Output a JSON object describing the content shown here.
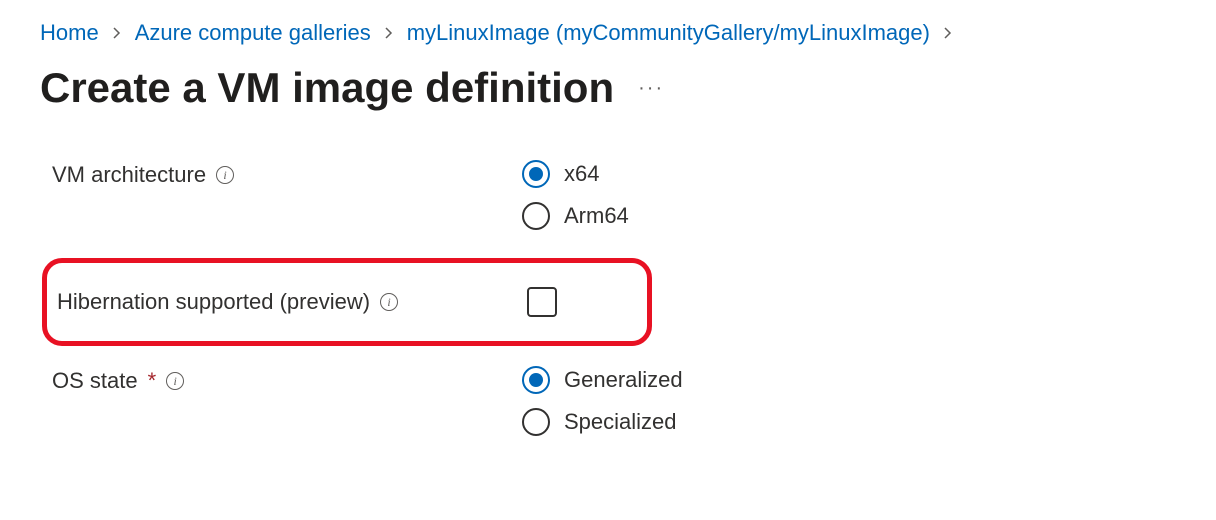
{
  "breadcrumb": {
    "home": "Home",
    "galleries": "Azure compute galleries",
    "image": "myLinuxImage (myCommunityGallery/myLinuxImage)"
  },
  "page": {
    "title": "Create a VM image definition"
  },
  "fields": {
    "arch": {
      "label": "VM architecture",
      "options": {
        "x64": "x64",
        "arm64": "Arm64"
      }
    },
    "hibernation": {
      "label": "Hibernation supported (preview)"
    },
    "osstate": {
      "label": "OS state",
      "options": {
        "gen": "Generalized",
        "spec": "Specialized"
      }
    }
  }
}
